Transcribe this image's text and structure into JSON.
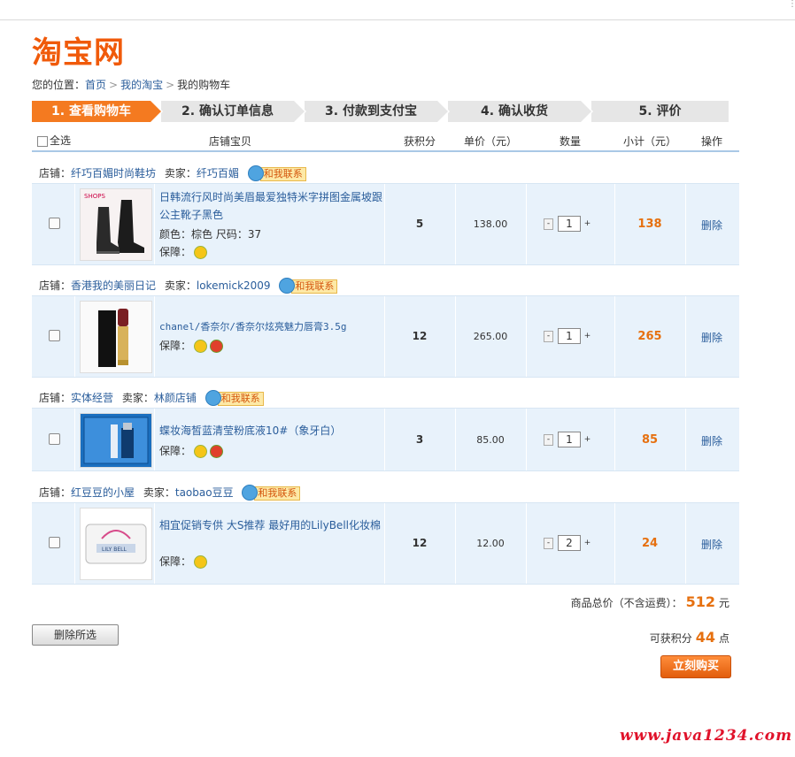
{
  "logo": "淘宝网",
  "breadcrumb": {
    "prefix": "您的位置：",
    "items": [
      "首页",
      "我的淘宝",
      "我的购物车"
    ]
  },
  "steps": [
    "1. 查看购物车",
    "2. 确认订单信息",
    "3. 付款到支付宝",
    "4. 确认收货",
    "5. 评价"
  ],
  "table_header": {
    "select_all": "全选",
    "item": "店铺宝贝",
    "points": "获积分",
    "unit_price": "单价（元）",
    "quantity": "数量",
    "subtotal": "小计（元）",
    "action": "操作"
  },
  "shop_label": "店铺：",
  "seller_label": "卖家：",
  "contact_label": "和我联系",
  "guarantee_label": "保障：",
  "delete_label": "删除",
  "shops": [
    {
      "shop_name": "纤巧百媚时尚鞋坊",
      "seller": "纤巧百媚",
      "item": {
        "name": "日韩流行风时尚美眉最爱独特米字拼图金属坡跟公主靴子黑色",
        "attrs": "颜色：棕色  尺码：37",
        "points": "5",
        "price": "138.00",
        "qty": "1",
        "subtotal": "138"
      }
    },
    {
      "shop_name": "香港我的美丽日记",
      "seller": "lokemick2009",
      "item": {
        "name": "chanel/香奈尔/香奈尔炫亮魅力唇膏3.5g",
        "attrs": "",
        "points": "12",
        "price": "265.00",
        "qty": "1",
        "subtotal": "265"
      }
    },
    {
      "shop_name": "实体经营",
      "seller": "林颜店铺",
      "item": {
        "name": "蝶妆海皙蓝清莹粉底液10#（象牙白）",
        "attrs": "",
        "points": "3",
        "price": "85.00",
        "qty": "1",
        "subtotal": "85"
      }
    },
    {
      "shop_name": "红豆豆的小屋",
      "seller": "taobao豆豆",
      "item": {
        "name": "相宜促销专供 大S推荐 最好用的LilyBell化妆棉",
        "attrs": "",
        "points": "12",
        "price": "12.00",
        "qty": "2",
        "subtotal": "24"
      }
    }
  ],
  "summary": {
    "total_label": "商品总价（不含运费）：",
    "total": "512",
    "total_unit": "元",
    "points_label": "可获积分",
    "points": "44",
    "points_unit": "点"
  },
  "buttons": {
    "delete_selected": "删除所选",
    "buy_now": "立刻购买"
  },
  "watermark": "www.java1234.com",
  "thumb_texts": {
    "boots": "SHOPS",
    "puff": "LILY BELL"
  },
  "colors": {
    "accent": "#f47a20",
    "link": "#2a5d9b",
    "price_highlight": "#e6700f",
    "row_bg": "#e8f2fb",
    "watermark": "#e0122a"
  }
}
